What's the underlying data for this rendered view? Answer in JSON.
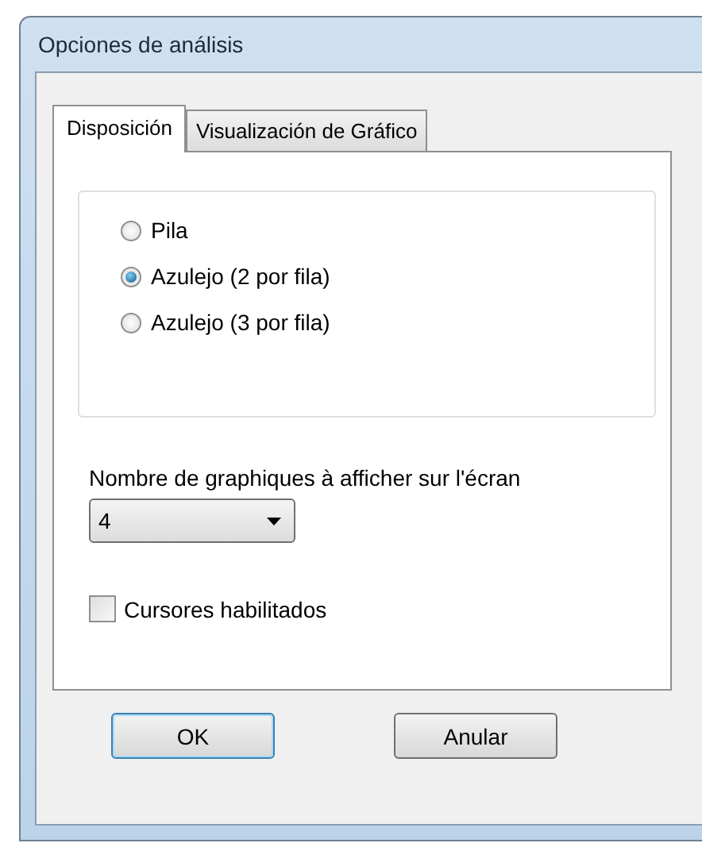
{
  "window": {
    "title": "Opciones de análisis"
  },
  "tabs": [
    {
      "label": "Disposición",
      "selected": true
    },
    {
      "label": "Visualización de Gráfico",
      "selected": false
    }
  ],
  "layout_options": [
    {
      "label": "Pila",
      "selected": false
    },
    {
      "label": "Azulejo (2 por fila)",
      "selected": true
    },
    {
      "label": "Azulejo (3 por fila)",
      "selected": false
    }
  ],
  "chart_count": {
    "label": "Nombre de graphiques à afficher sur l'écran",
    "value": "4"
  },
  "cursors": {
    "label": "Cursores habilitados",
    "checked": false
  },
  "buttons": [
    {
      "label": "OK",
      "default": true
    },
    {
      "label": "Anular",
      "default": false
    }
  ]
}
